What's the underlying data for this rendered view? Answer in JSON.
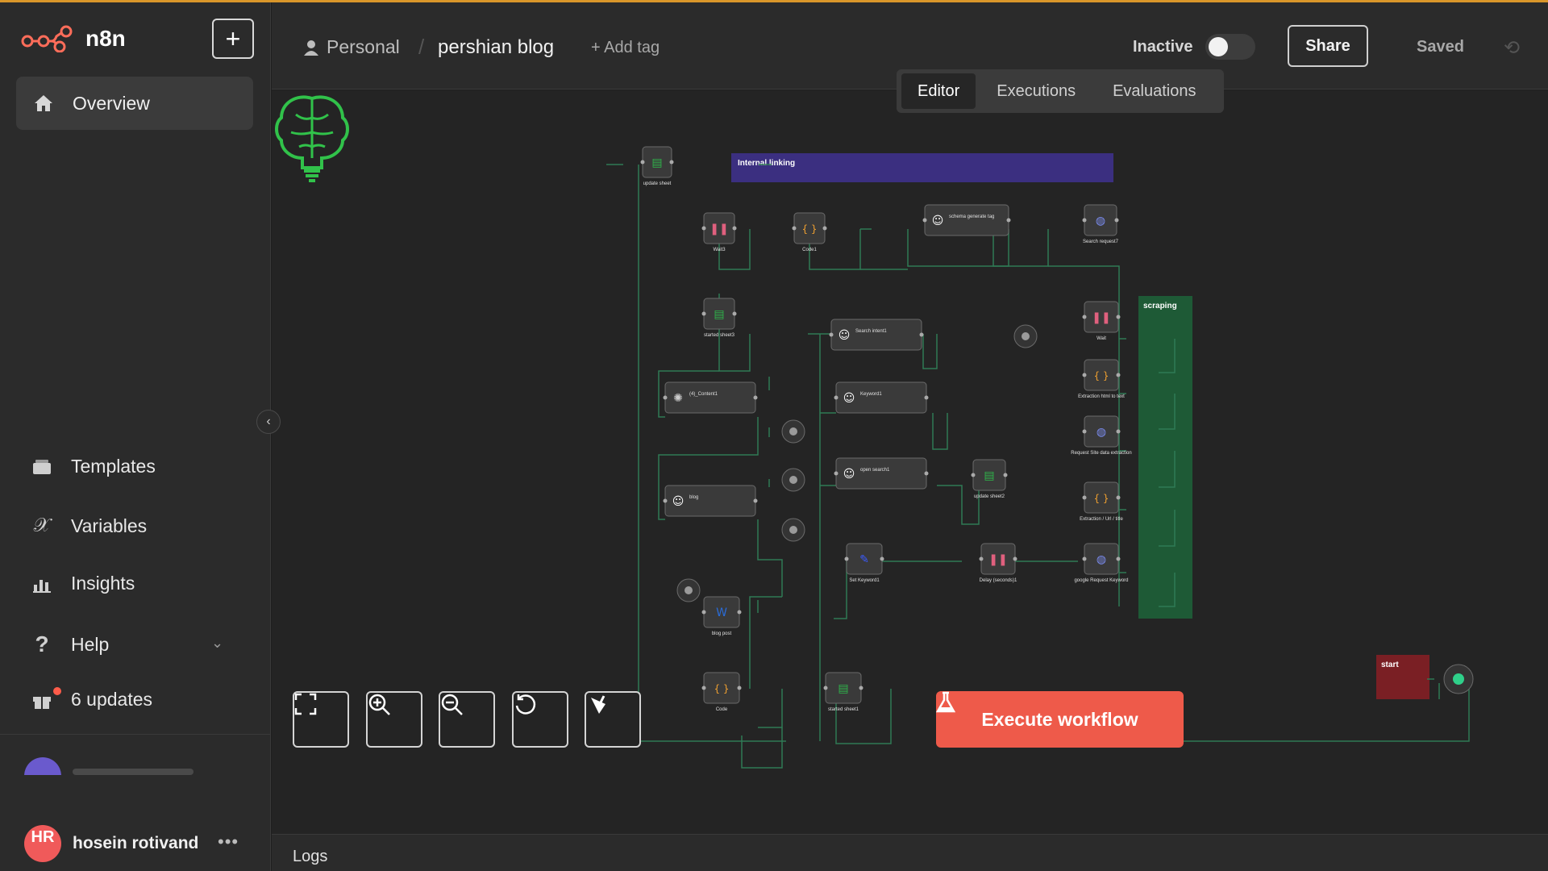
{
  "app": {
    "name": "n8n"
  },
  "sidebar": {
    "overview": "Overview",
    "items": [
      {
        "label": "Templates",
        "icon": "templates-icon"
      },
      {
        "label": "Variables",
        "icon": "variables-icon"
      },
      {
        "label": "Insights",
        "icon": "insights-icon"
      },
      {
        "label": "Help",
        "icon": "help-icon"
      },
      {
        "label": "6 updates",
        "icon": "gift-icon"
      }
    ],
    "user": {
      "initials": "HR",
      "name": "hosein rotivand"
    }
  },
  "header": {
    "project": "Personal",
    "workflow_title": "pershian blog",
    "add_tag": "+ Add tag",
    "status": "Inactive",
    "share": "Share",
    "saved": "Saved"
  },
  "tabs": [
    "Editor",
    "Executions",
    "Evaluations"
  ],
  "canvas": {
    "sticky_notes": [
      {
        "label": "Internal linking",
        "color": "#3b2f80"
      },
      {
        "label": "scraping",
        "color": "#1e5a36"
      },
      {
        "label": "start",
        "color": "#7a1f24"
      }
    ],
    "nodes": [
      {
        "label": "update sheet",
        "kind": "sheets"
      },
      {
        "label": "Wait3",
        "kind": "wait"
      },
      {
        "label": "Code1",
        "kind": "code"
      },
      {
        "label": "schema generate tag",
        "kind": "agent"
      },
      {
        "label": "Search request7",
        "kind": "http"
      },
      {
        "label": "started sheet3",
        "kind": "sheets"
      },
      {
        "label": "Search intent1",
        "kind": "agent"
      },
      {
        "label": "(4)_Content1",
        "kind": "openai"
      },
      {
        "label": "Keyword1",
        "kind": "agent"
      },
      {
        "label": "open search1",
        "kind": "agent"
      },
      {
        "label": "update sheet2",
        "kind": "sheets"
      },
      {
        "label": "blog",
        "kind": "agent"
      },
      {
        "label": "Set Keyword1",
        "kind": "set"
      },
      {
        "label": "Delay (seconds)1",
        "kind": "wait"
      },
      {
        "label": "google Request Keyword",
        "kind": "http"
      },
      {
        "label": "blog post",
        "kind": "wordpress"
      },
      {
        "label": "Code",
        "kind": "code"
      },
      {
        "label": "started sheet1",
        "kind": "sheets"
      },
      {
        "label": "Wait",
        "kind": "wait"
      },
      {
        "label": "Extraction html to text",
        "kind": "code"
      },
      {
        "label": "Request Site data extraction",
        "kind": "http"
      },
      {
        "label": "Extraction / Url / title",
        "kind": "code"
      }
    ]
  },
  "controls": {
    "execute": "Execute workflow"
  },
  "logs": {
    "label": "Logs"
  },
  "colors": {
    "accent": "#ee5a4a",
    "node_bg": "#3a3a3a",
    "connection": "#2f7a55",
    "brand": "#ff6d5a"
  }
}
